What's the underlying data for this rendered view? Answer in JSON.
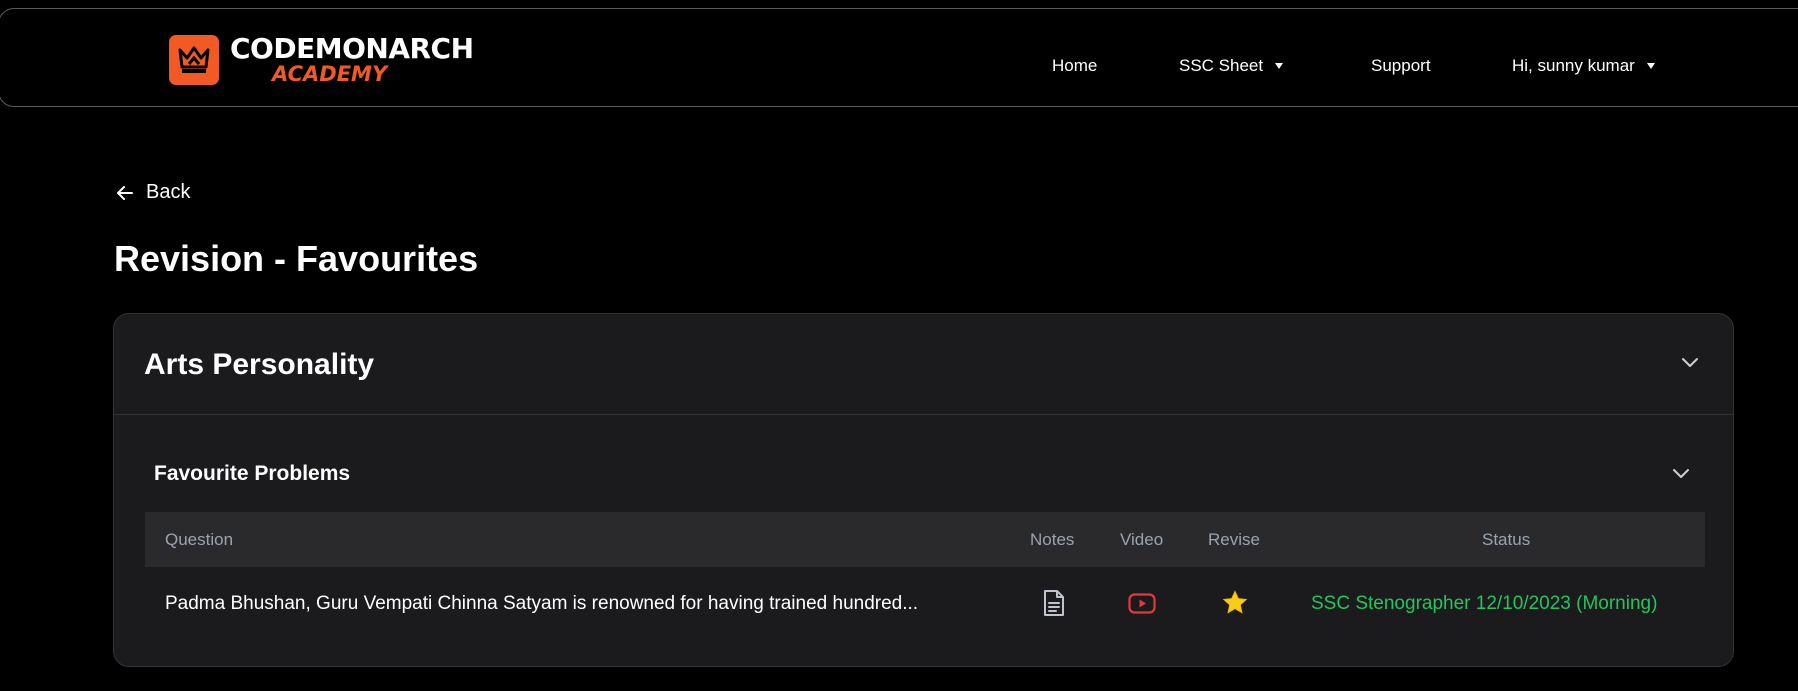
{
  "navbar": {
    "logo_line1": "CODEMONARCH",
    "logo_line2": "ACADEMY",
    "items": {
      "home": "Home",
      "ssc_sheet": "SSC Sheet",
      "support": "Support",
      "user": "Hi, sunny kumar"
    }
  },
  "back_label": "Back",
  "page_title": "Revision - Favourites",
  "card": {
    "title": "Arts Personality",
    "subsection_title": "Favourite Problems",
    "columns": {
      "question": "Question",
      "notes": "Notes",
      "video": "Video",
      "revise": "Revise",
      "status": "Status"
    },
    "rows": [
      {
        "question": "Padma Bhushan, Guru Vempati Chinna Satyam is renowned for having trained hundred...",
        "notes_icon": "document-icon",
        "video_icon": "youtube-icon",
        "revise_icon": "star-icon",
        "status": "SSC Stenographer 12/10/2023 (Morning)"
      }
    ]
  },
  "colors": {
    "brand": "#f15a24",
    "status_green": "#22c55e",
    "video_red": "#e5383b",
    "star_yellow": "#facc15",
    "card_bg": "#1b1b1d"
  }
}
